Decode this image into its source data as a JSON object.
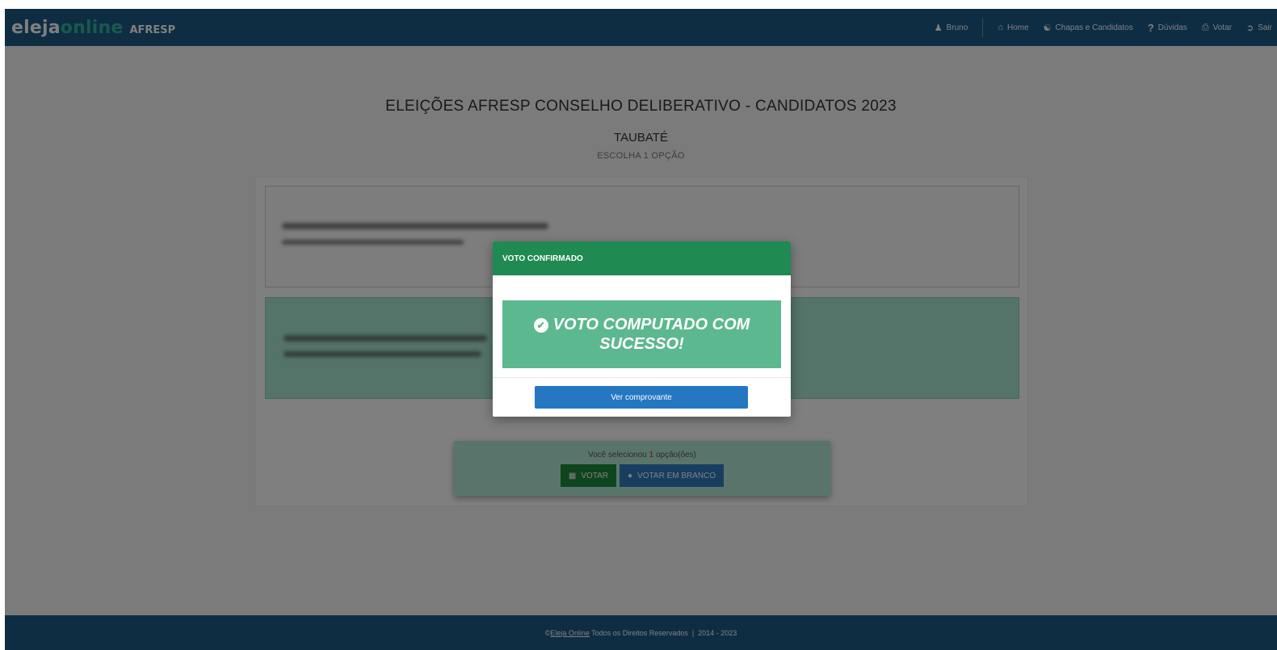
{
  "navbar": {
    "brand_part1": "eleja",
    "brand_o": "o",
    "brand_part2": "nline",
    "brand_org": "AFRESP",
    "user_label": "Bruno",
    "home_label": "Home",
    "chapas_label": "Chapas e Candidatos",
    "duvidas_label": "Dúvidas",
    "votar_label": "Votar",
    "sair_label": "Sair"
  },
  "main": {
    "title": "ELEIÇÕES AFRESP CONSELHO DELIBERATIVO - CANDIDATOS 2023",
    "subtitle": "TAUBATÉ",
    "hint": "ESCOLHA 1 OPÇÃO"
  },
  "vote_panel": {
    "info_prefix": "Você selecionou",
    "count": "1",
    "info_suffix": "opção(ões)",
    "vote_label": "VOTAR",
    "blank_label": "VOTAR EM BRANCO"
  },
  "footer": {
    "copyright_symbol": "©",
    "link": "Eleja Online",
    "text": " Todos os Direitos Reservados  |  2014 - 2023"
  },
  "modal": {
    "header": "VOTO CONFIRMADO",
    "message": "VOTO COMPUTADO COM SUCESSO!",
    "button": "Ver comprovante"
  },
  "colors": {
    "navbar": "#1d5b86",
    "brand_accent": "#2fb59a",
    "modal_header": "#1f8a52",
    "success_alert": "#5cb88e",
    "primary_button": "#2577c2",
    "selected_candidate": "#a9e7d2"
  },
  "icons": {
    "user": "user-icon",
    "home": "home-icon",
    "chapas": "users-icon",
    "duvidas": "question-icon",
    "votar": "print-icon",
    "sair": "sign-out-icon",
    "vote_button": "clipboard-icon",
    "blank_button": "circle-icon",
    "success": "check-circle-icon"
  }
}
